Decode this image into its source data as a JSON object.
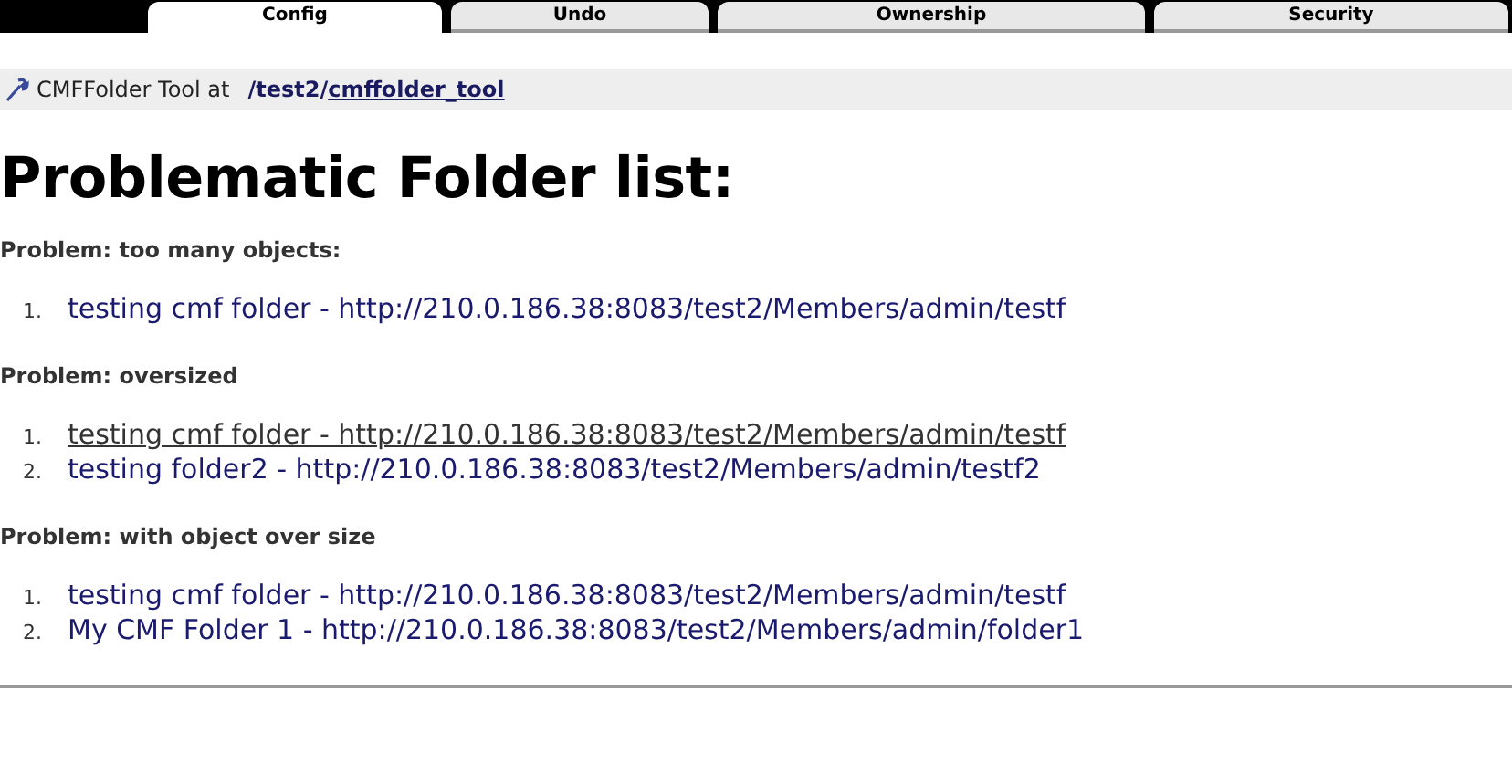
{
  "tabs": [
    {
      "label": "Config",
      "selected": true
    },
    {
      "label": "Undo",
      "selected": false
    },
    {
      "label": "Ownership",
      "selected": false
    },
    {
      "label": "Security",
      "selected": false
    }
  ],
  "breadcrumb": {
    "prefix": "CMFFolder Tool at",
    "path": "/test2/",
    "link": "cmffolder_tool"
  },
  "heading": "Problematic Folder list:",
  "sections": [
    {
      "title": "Problem: too many objects:",
      "items": [
        {
          "number": "1.",
          "text": "testing cmf folder - http://210.0.186.38:8083/test2/Members/admin/testf",
          "underlined": false
        }
      ]
    },
    {
      "title": "Problem: oversized",
      "items": [
        {
          "number": "1.",
          "text": "testing cmf folder - http://210.0.186.38:8083/test2/Members/admin/testf",
          "underlined": true
        },
        {
          "number": "2.",
          "text": "testing folder2 - http://210.0.186.38:8083/test2/Members/admin/testf2",
          "underlined": false
        }
      ]
    },
    {
      "title": "Problem: with object over size",
      "items": [
        {
          "number": "1.",
          "text": "testing cmf folder - http://210.0.186.38:8083/test2/Members/admin/testf",
          "underlined": false
        },
        {
          "number": "2.",
          "text": "My CMF Folder 1 - http://210.0.186.38:8083/test2/Members/admin/folder1",
          "underlined": false
        }
      ]
    }
  ]
}
